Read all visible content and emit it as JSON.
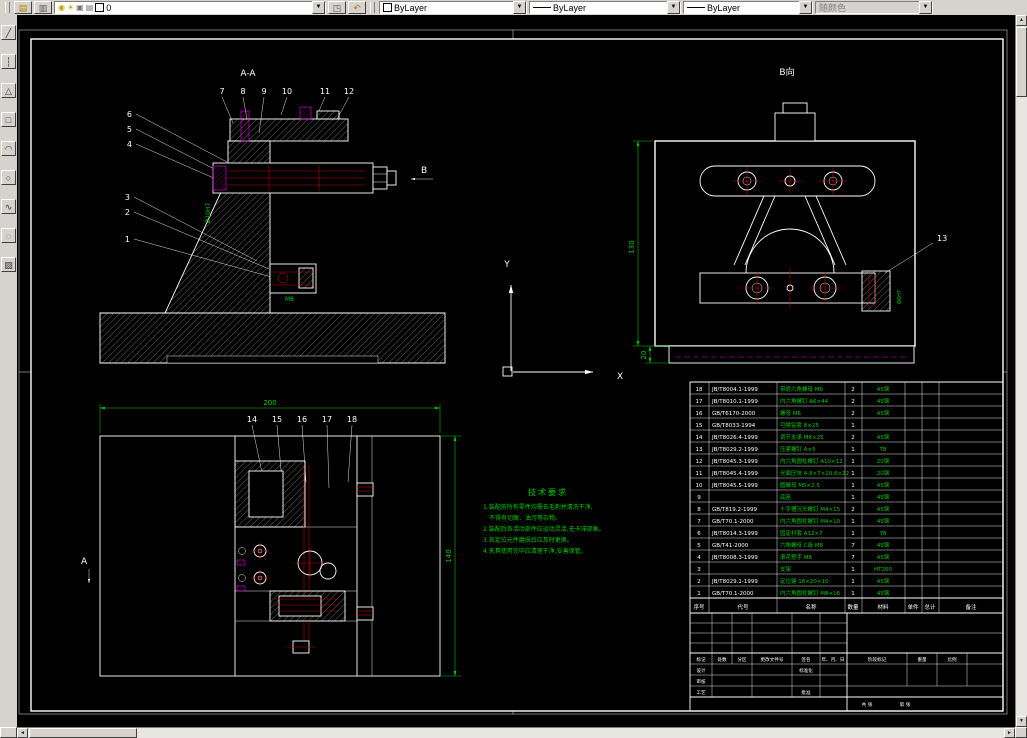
{
  "colors": {
    "canvas": "#000000",
    "line": "#ffffff",
    "dim_green": "#00cc00",
    "detail_red": "#c80000",
    "aux_magenta": "#dd00dd"
  },
  "toolbar": {
    "layer_name": "0",
    "color": "ByLayer",
    "linetype": "ByLayer",
    "lineweight": "ByLayer",
    "plot_style": "随颜色"
  },
  "draw_tools": [
    {
      "glyph": "╱"
    },
    {
      "glyph": "┆"
    },
    {
      "glyph": "△"
    },
    {
      "glyph": "□"
    },
    {
      "glyph": "◠"
    },
    {
      "glyph": "○"
    },
    {
      "glyph": "∿"
    },
    {
      "glyph": "◌"
    },
    {
      "glyph": "▨"
    }
  ],
  "drawing": {
    "labels": {
      "section_aa": "A-A",
      "view_b": "B向",
      "arrow_b": "B",
      "section_a": "A",
      "ucs_x": "X",
      "ucs_y": "Y"
    },
    "callouts": {
      "aa_top": [
        "7",
        "8",
        "9",
        "10",
        "11",
        "12"
      ],
      "aa_left": [
        "6",
        "5",
        "4",
        "3",
        "2",
        "1"
      ],
      "plan": [
        "14",
        "15",
        "16",
        "17",
        "18"
      ],
      "b_view": "13"
    },
    "dims": {
      "plan_width": "200",
      "plan_height": "140",
      "b_height": "130",
      "b_base": "20",
      "shaft": "Ø10H7",
      "clamp": "M8",
      "pin": "Ø6H7"
    },
    "tech_notes": {
      "title": "技术要求",
      "lines": [
        "1.装配前所有零件均需去毛刺并清洗干净,",
        "不得有切屑、油污等杂物。",
        "2.装配后各活动部件应运动灵活,无卡滞现象。",
        "3.各定位元件磨损后应及时更换。",
        "4.夹具使用完毕应清理干净,妥善保管。"
      ]
    }
  },
  "bom": {
    "headers": [
      "序号",
      "代号",
      "名称",
      "数量",
      "材料",
      "单件",
      "总计",
      "备注"
    ],
    "rows": [
      {
        "no": "18",
        "code": "JB/T8004.1-1999",
        "name": "带肩六角螺母 M6",
        "qty": "2",
        "material": "45钢"
      },
      {
        "no": "17",
        "code": "JB/T8010.1-1999",
        "name": "内六角螺钉 A6×44",
        "qty": "2",
        "material": "45钢"
      },
      {
        "no": "16",
        "code": "GB/T6170-2000",
        "name": "螺母 M6",
        "qty": "2",
        "material": "45钢"
      },
      {
        "no": "15",
        "code": "GB/T8033-1994",
        "name": "可换钻套 8×25",
        "qty": "1",
        "material": ""
      },
      {
        "no": "14",
        "code": "JB/T8026.4-1999",
        "name": "调节支承 M6×25",
        "qty": "2",
        "material": "45钢"
      },
      {
        "no": "13",
        "code": "JB/T8029.2-1999",
        "name": "压紧螺钉 A×5",
        "qty": "1",
        "material": "T8"
      },
      {
        "no": "12",
        "code": "JB/T8045.3-1999",
        "name": "内六角圆柱螺钉 A10×12",
        "qty": "1",
        "material": "20钢"
      },
      {
        "no": "11",
        "code": "JB/T8045.4-1999",
        "name": "光面压块 4.8×7×10.6×12",
        "qty": "1",
        "material": "20钢"
      },
      {
        "no": "10",
        "code": "JB/T8045.5-1999",
        "name": "圆螺母 M5×2.5",
        "qty": "1",
        "material": "45钢"
      },
      {
        "no": "9",
        "code": "",
        "name": "底座",
        "qty": "1",
        "material": "45钢"
      },
      {
        "no": "8",
        "code": "GB/T819.2-1999",
        "name": "十字槽沉头螺钉 M4×15",
        "qty": "2",
        "material": "45钢"
      },
      {
        "no": "7",
        "code": "GB/T70.1-2000",
        "name": "内六角圆柱螺钉 M4×10",
        "qty": "1",
        "material": "45钢"
      },
      {
        "no": "6",
        "code": "JB/T8014.3-1999",
        "name": "固定衬套 A12×7",
        "qty": "1",
        "material": "T8"
      },
      {
        "no": "5",
        "code": "GB/T41-2000",
        "name": "六角螺母 C级 M6",
        "qty": "7",
        "material": "45钢"
      },
      {
        "no": "4",
        "code": "JB/T8008.3-1999",
        "name": "滚花把手 M6",
        "qty": "7",
        "material": "45钢"
      },
      {
        "no": "3",
        "code": "",
        "name": "支架",
        "qty": "1",
        "material": "HT200"
      },
      {
        "no": "2",
        "code": "JB/T8029.1-1999",
        "name": "定位键 16×20×10",
        "qty": "1",
        "material": "45钢"
      },
      {
        "no": "1",
        "code": "GB/T70.1-2000",
        "name": "内六角圆柱螺钉 M8×16",
        "qty": "1",
        "material": "45钢"
      }
    ]
  },
  "title_block": {
    "rev": [
      "标记",
      "处数",
      "分区",
      "更改文件号",
      "签名",
      "年、月、日"
    ],
    "design": "设计",
    "standardize": "标准化",
    "check": "审核",
    "process": "工艺",
    "approve": "批准",
    "stage": "阶段标记",
    "weight": "重量",
    "scale": "比例",
    "sheets_total": "共  张",
    "sheet_no": "第  张"
  }
}
